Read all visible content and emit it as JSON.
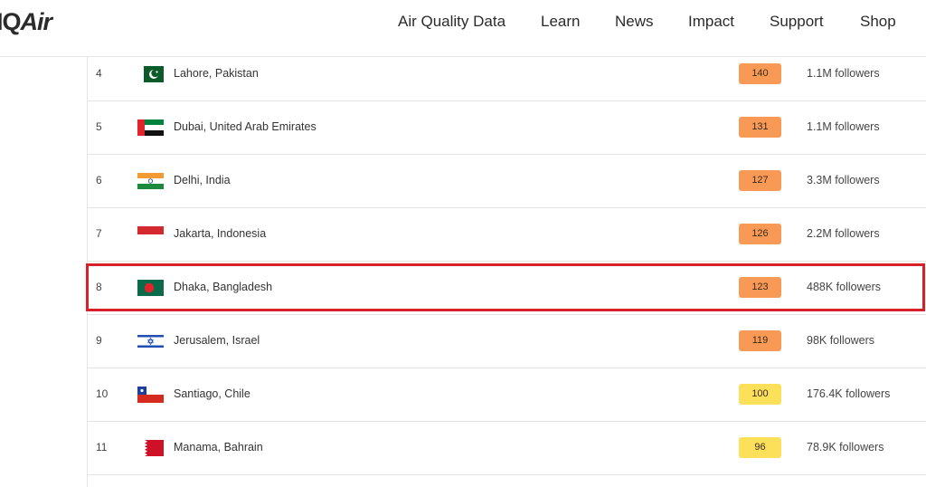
{
  "header": {
    "logo_prefix": "IQ",
    "logo_suffix": "Air",
    "nav": [
      "Air Quality Data",
      "Learn",
      "News",
      "Impact",
      "Support",
      "Shop"
    ]
  },
  "ranking": {
    "rows": [
      {
        "rank": "4",
        "city": "Lahore, Pakistan",
        "aqi": "140",
        "followers": "1.1M followers",
        "flag": "pakistan-flag",
        "aqi_color": "#f89a55"
      },
      {
        "rank": "5",
        "city": "Dubai, United Arab Emirates",
        "aqi": "131",
        "followers": "1.1M followers",
        "flag": "uae-flag",
        "aqi_color": "#f89a55"
      },
      {
        "rank": "6",
        "city": "Delhi, India",
        "aqi": "127",
        "followers": "3.3M followers",
        "flag": "india-flag",
        "aqi_color": "#f89a55"
      },
      {
        "rank": "7",
        "city": "Jakarta, Indonesia",
        "aqi": "126",
        "followers": "2.2M followers",
        "flag": "indonesia-flag",
        "aqi_color": "#f89a55"
      },
      {
        "rank": "8",
        "city": "Dhaka, Bangladesh",
        "aqi": "123",
        "followers": "488K followers",
        "flag": "bangladesh-flag",
        "aqi_color": "#f89a55"
      },
      {
        "rank": "9",
        "city": "Jerusalem, Israel",
        "aqi": "119",
        "followers": "98K followers",
        "flag": "israel-flag",
        "aqi_color": "#f89a55"
      },
      {
        "rank": "10",
        "city": "Santiago, Chile",
        "aqi": "100",
        "followers": "176.4K followers",
        "flag": "chile-flag",
        "aqi_color": "#fde05a"
      },
      {
        "rank": "11",
        "city": "Manama, Bahrain",
        "aqi": "96",
        "followers": "78.9K followers",
        "flag": "bahrain-flag",
        "aqi_color": "#fde05a"
      }
    ]
  }
}
